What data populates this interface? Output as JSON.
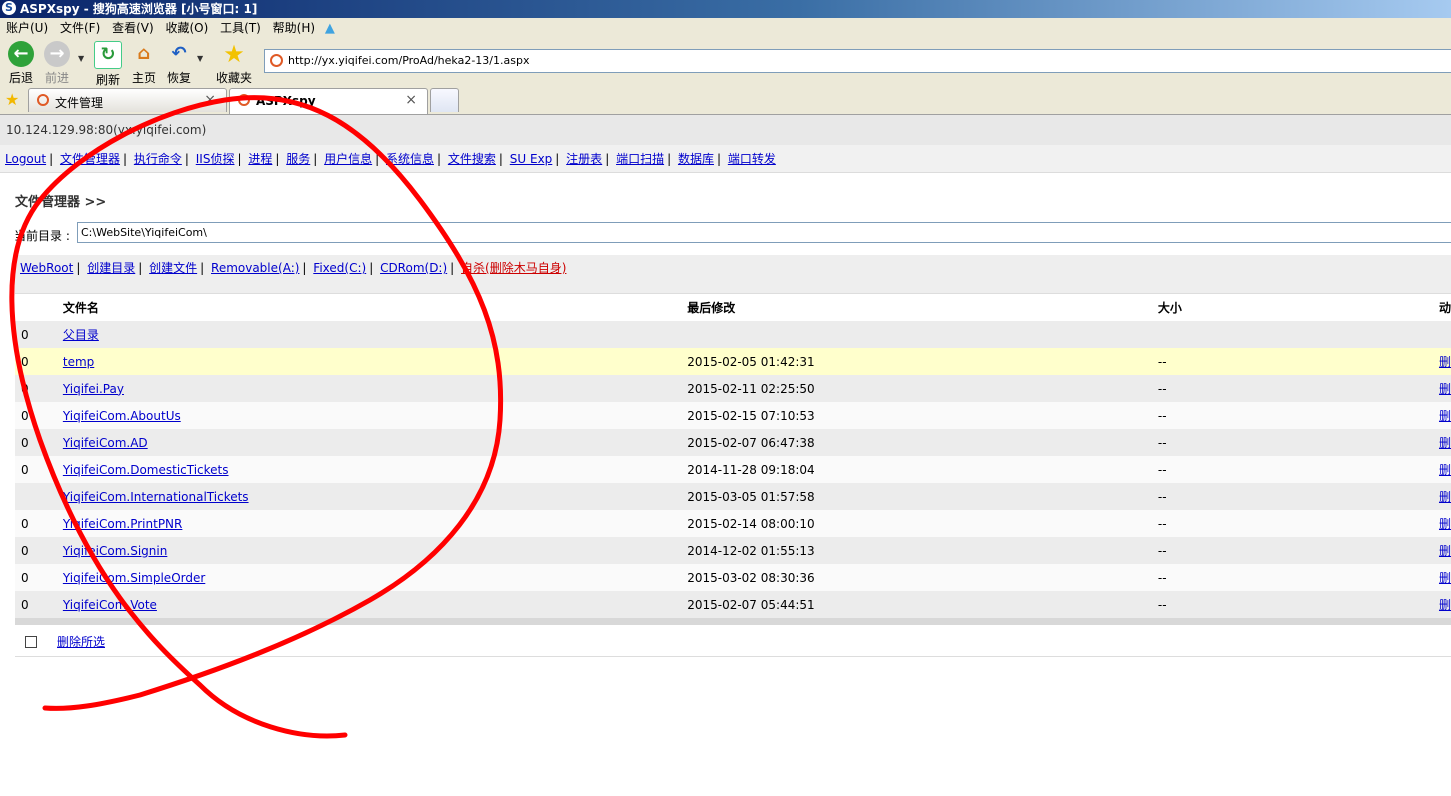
{
  "window": {
    "title": "ASPXspy - 搜狗高速浏览器 [小号窗口: 1]"
  },
  "menu": [
    "账户(U)",
    "文件(F)",
    "查看(V)",
    "收藏(O)",
    "工具(T)",
    "帮助(H)"
  ],
  "toolbar": {
    "back": "后退",
    "forward": "前进",
    "refresh": "刷新",
    "home": "主页",
    "restore": "恢复",
    "favorites": "收藏夹"
  },
  "address": {
    "url": "http://yx.yiqifei.com/ProAd/heka2-13/1.aspx"
  },
  "tabs": [
    {
      "label": "文件管理",
      "close": "×"
    },
    {
      "label": "ASPXspy",
      "close": "×"
    }
  ],
  "page": {
    "host": "10.124.129.98:80(yx.yiqifei.com)",
    "nav": [
      "Logout",
      "文件管理器",
      "执行命令",
      "IIS侦探",
      "进程",
      "服务",
      "用户信息",
      "系统信息",
      "文件搜索",
      "SU Exp",
      "注册表",
      "端口扫描",
      "数据库",
      "端口转发"
    ],
    "fm_title": "文件管理器 >>",
    "curdir_label": "当前目录 :",
    "curdir_value": "C:\\WebSite\\YiqifeiCom\\",
    "drives": [
      "WebRoot",
      "创建目录",
      "创建文件",
      "Removable(A:)",
      "Fixed(C:)",
      "CDRom(D:)"
    ],
    "self_delete": "自杀(删除木马自身)",
    "headers": {
      "name": "文件名",
      "modified": "最后修改",
      "size": "大小",
      "action": "动"
    },
    "rows": [
      {
        "idx": "0",
        "name": "父目录",
        "modified": "",
        "size": "",
        "action": ""
      },
      {
        "idx": "0",
        "name": "temp",
        "modified": "2015-02-05 01:42:31",
        "size": "--",
        "action": "删"
      },
      {
        "idx": "0",
        "name": "Yiqifei.Pay",
        "modified": "2015-02-11 02:25:50",
        "size": "--",
        "action": "删"
      },
      {
        "idx": "0",
        "name": "YiqifeiCom.AboutUs",
        "modified": "2015-02-15 07:10:53",
        "size": "--",
        "action": "删"
      },
      {
        "idx": "0",
        "name": "YiqifeiCom.AD",
        "modified": "2015-02-07 06:47:38",
        "size": "--",
        "action": "删"
      },
      {
        "idx": "0",
        "name": "YiqifeiCom.DomesticTickets",
        "modified": "2014-11-28 09:18:04",
        "size": "--",
        "action": "删"
      },
      {
        "idx": "",
        "name": "YiqifeiCom.InternationalTickets",
        "modified": "2015-03-05 01:57:58",
        "size": "--",
        "action": "删"
      },
      {
        "idx": "0",
        "name": "YiqifeiCom.PrintPNR",
        "modified": "2015-02-14 08:00:10",
        "size": "--",
        "action": "删"
      },
      {
        "idx": "0",
        "name": "YiqifeiCom.Signin",
        "modified": "2014-12-02 01:55:13",
        "size": "--",
        "action": "删"
      },
      {
        "idx": "0",
        "name": "YiqifeiCom.SimpleOrder",
        "modified": "2015-03-02 08:30:36",
        "size": "--",
        "action": "删"
      },
      {
        "idx": "0",
        "name": "YiqifeiCom.Vote",
        "modified": "2015-02-07 05:44:51",
        "size": "--",
        "action": "删"
      }
    ],
    "delete_selected": "删除所选"
  },
  "colors": {
    "annotation": "#ff0000",
    "highlight_row": "#ffffcc",
    "link": "#0000cc"
  }
}
